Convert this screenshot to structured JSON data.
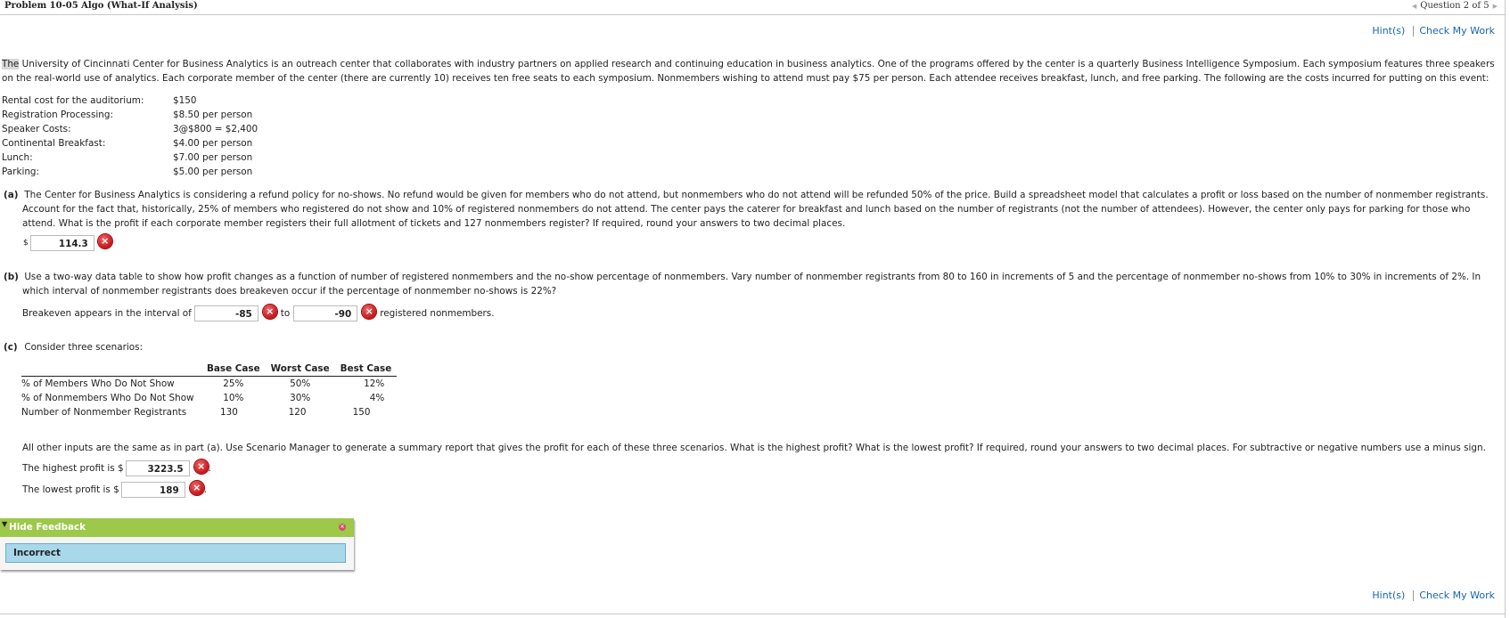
{
  "header": {
    "title": "Problem 10-05 Algo (What-If Analysis)",
    "question_nav": "Question 2 of 5",
    "prev_icon": "triangle-left-icon",
    "next_icon": "triangle-right-icon"
  },
  "links": {
    "hints": "Hint(s)",
    "check": "Check My Work"
  },
  "intro": {
    "first_word": "The",
    "text": " University of Cincinnati Center for Business Analytics is an outreach center that collaborates with industry partners on applied research and continuing education in business analytics. One of the programs offered by the center is a quarterly Business Intelligence Symposium. Each symposium features three speakers on the real-world use of analytics. Each corporate member of the center (there are currently 10) receives ten free seats to each symposium. Nonmembers wishing to attend must pay $75 per person. Each attendee receives breakfast, lunch, and free parking. The following are the costs incurred for putting on this event:"
  },
  "costs": [
    {
      "label": "Rental cost for the auditorium:",
      "value": "$150"
    },
    {
      "label": "Registration Processing:",
      "value": "$8.50 per person"
    },
    {
      "label": "Speaker Costs:",
      "value": "3@$800 = $2,400"
    },
    {
      "label": "Continental Breakfast:",
      "value": "$4.00 per person"
    },
    {
      "label": "Lunch:",
      "value": "$7.00 per person"
    },
    {
      "label": "Parking:",
      "value": "$5.00 per person"
    }
  ],
  "part_a": {
    "tag": "(a)",
    "text": "The Center for Business Analytics is considering a refund policy for no-shows. No refund would be given for members who do not attend, but nonmembers who do not attend will be refunded 50% of the price. Build a spreadsheet model that calculates a profit or loss based on the number of nonmember registrants. Account for the fact that, historically, 25% of members who registered do not show and 10% of registered nonmembers do not attend. The center pays the caterer for breakfast and lunch based on the number of registrants (not the number of attendees). However, the center only pays for parking for those who attend. What is the profit if each corporate member registers their full allotment of tickets and 127 nonmembers register? If required, round your answers to two decimal places.",
    "currency": "$",
    "answer": "114.3",
    "status": "incorrect"
  },
  "part_b": {
    "tag": "(b)",
    "text": "Use a two-way data table to show how profit changes as a function of number of registered nonmembers and the no-show percentage of nonmembers. Vary number of nonmember registrants from 80 to 160 in increments of 5 and the percentage of nonmember no-shows from 10% to 30% in increments of 2%. In which interval of nonmember registrants does breakeven occur if the percentage of nonmember no-shows is 22%?",
    "prefix": "Breakeven appears in the interval of",
    "between": "to",
    "suffix": "registered nonmembers.",
    "answer_low": "-85",
    "answer_high": "-90",
    "status": "incorrect"
  },
  "part_c": {
    "tag": "(c)",
    "intro": "Consider three scenarios:",
    "table": {
      "headers": [
        "",
        "Base Case",
        "Worst Case",
        "Best Case"
      ],
      "rows": [
        {
          "label": "% of Members Who Do Not Show",
          "values": [
            "25%",
            "50%",
            "12%"
          ]
        },
        {
          "label": "% of Nonmembers Who Do Not Show",
          "values": [
            "10%",
            "30%",
            "4%"
          ]
        },
        {
          "label": "Number of Nonmember Registrants",
          "values": [
            "130",
            "120",
            "150"
          ]
        }
      ]
    },
    "text": "All other inputs are the same as in part (a). Use Scenario Manager to generate a summary report that gives the profit for each of these three scenarios. What is the highest profit? What is the lowest profit? If required, round your answers to two decimal places. For subtractive or negative numbers use a minus sign.",
    "highest_label": "The highest profit is $",
    "highest_answer": "3223.5",
    "lowest_label": "The lowest profit is $",
    "lowest_answer": "189",
    "period": ".",
    "status": "incorrect"
  },
  "feedback": {
    "toggle_label": "Hide Feedback",
    "result": "Incorrect",
    "header_color": "#9dc84a",
    "result_color": "#a8d8ea"
  },
  "icons": {
    "incorrect": "×"
  }
}
